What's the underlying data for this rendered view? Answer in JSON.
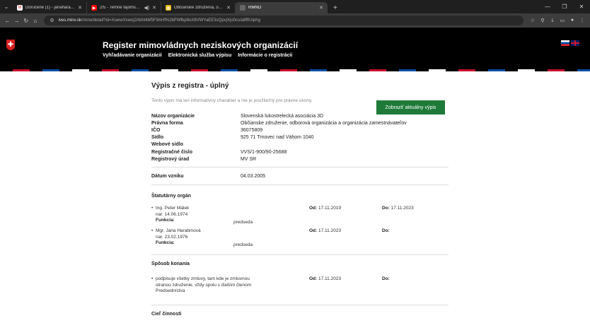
{
  "browser": {
    "tabs": [
      {
        "title": "Doručené (1) - janaharabinova...",
        "icon_color": "#d93025",
        "icon": "M",
        "active": false
      },
      {
        "title": "2/5 - Temné tajomstvá Vati...",
        "icon_color": "#ff0000",
        "icon": "▶",
        "active": false
      },
      {
        "title": "Občianske združenia, odborové...",
        "icon_color": "#e8b400",
        "icon": "▦",
        "active": false
      },
      {
        "title": "RMNO",
        "icon_color": "#555555",
        "icon": "",
        "active": true
      }
    ],
    "new_tab": "+",
    "url_host": "ives.minv.sk",
    "url_path": "/rmno/detail?id=XuwwXxwoj2Abht4bf5F9AHf%2bFWfbp9oX8VWYaEE3sQpvjXjo0cs/a8fftUiphg"
  },
  "site": {
    "title": "Register mimovládnych neziskových organizácií",
    "nav": [
      "Vyhľadávanie organizácií",
      "Elektronická služba výpisu",
      "Informácie o registrácii"
    ],
    "coat_glyph": "✚"
  },
  "page": {
    "heading": "Výpis z registra  - úplný",
    "current_button": "Zobraziť aktuálny výpis",
    "note": "Tento výpis má len informatívny charakter a nie je použiteľný pre právne úkony.",
    "fields": [
      {
        "label": "Názov organizácie",
        "value": "Slovenská lukostrelecká asociácia 3D"
      },
      {
        "label": "Právna forma",
        "value": "Občianske združenie, odborová organizácia a organizácia zamestnávateľov"
      },
      {
        "label": "IČO",
        "value": "36075809"
      },
      {
        "label": "Sídlo",
        "value": "925 71 Trnovec nad Váhom 1040"
      },
      {
        "label": "Webové sídlo",
        "value": ""
      },
      {
        "label": "Registračné číslo",
        "value": "VVS/1-900/90-25688"
      },
      {
        "label": "Registrový úrad",
        "value": "MV SR"
      }
    ],
    "founded_label": "Dátum vzniku",
    "founded_value": "04.03.2005",
    "statutory_heading": "Štatutárny orgán",
    "od_label": "Od:",
    "do_label": "Do:",
    "function_label": "Funkcia:",
    "persons": [
      {
        "name": "Ing. Peter Málek",
        "born": "nar. 14.06.1974",
        "function": "predseda",
        "od": "17.11.2019",
        "do": "17.11.2023"
      },
      {
        "name": "Mgr. Jana Harabinová",
        "born": "nar. 23.02.1976",
        "function": "predseda",
        "od": "17.11.2023",
        "do": ""
      }
    ],
    "conduct_heading": "Spôsob konania",
    "conduct": {
      "line1": "podpisuje všetky zmluvy, tam kde je zmluvnou",
      "line2": "stranou združenie, vždy spolu s ďalším členom",
      "line3": "Predsedníctva",
      "od": "17.11.2023",
      "do": ""
    },
    "goal_heading": "Cieľ činnosti"
  }
}
